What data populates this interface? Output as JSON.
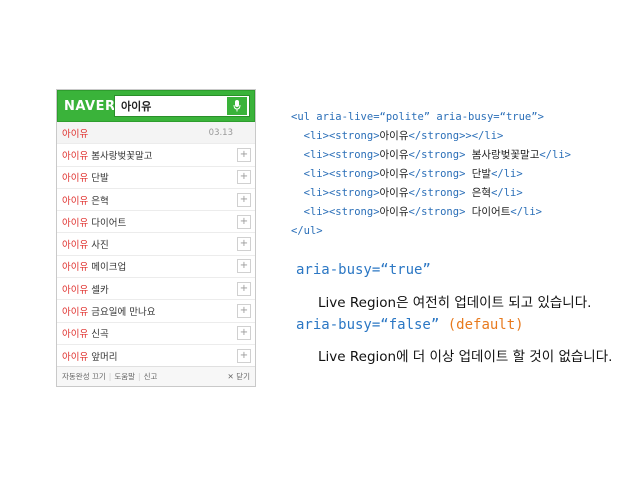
{
  "widget": {
    "logo": "NAVER",
    "query": "아이유",
    "suggestions": [
      {
        "hl": "아이유",
        "rest": "",
        "date": "03.13"
      },
      {
        "hl": "아이유",
        "rest": " 봄사랑벚꽃말고"
      },
      {
        "hl": "아이유",
        "rest": " 단발"
      },
      {
        "hl": "아이유",
        "rest": " 은혁"
      },
      {
        "hl": "아이유",
        "rest": " 다이어트"
      },
      {
        "hl": "아이유",
        "rest": " 사진"
      },
      {
        "hl": "아이유",
        "rest": " 메이크업"
      },
      {
        "hl": "아이유",
        "rest": " 셀카"
      },
      {
        "hl": "아이유",
        "rest": " 금요일에 만나요"
      },
      {
        "hl": "아이유",
        "rest": " 신곡"
      },
      {
        "hl": "아이유",
        "rest": " 앞머리"
      }
    ],
    "plus_label": "+",
    "footer": {
      "autocomplete": "자동완성 끄기",
      "help": "도움말",
      "report": "신고",
      "close": "✕ 닫기",
      "sep": "|"
    }
  },
  "code": {
    "line1_open": "<ul ",
    "line1_attr1": "aria-live=",
    "line1_val1": "“polite”",
    "line1_attr2": " aria-busy=",
    "line1_val2": "“true”",
    "line1_close": ">",
    "li_open": "<li><strong>",
    "strong_close": "</strong>",
    "li_close": "</li>",
    "ul_close": "</ul>",
    "items": [
      {
        "name": "아이유",
        "after": "",
        "suffix": "></li>"
      },
      {
        "name": "아이유",
        "after": "봄사랑벚꽃말고"
      },
      {
        "name": "아이유",
        "after": "단발"
      },
      {
        "name": "아이유",
        "after": "은혁"
      },
      {
        "name": "아이유",
        "after": "다이어트"
      }
    ]
  },
  "explanation": {
    "busy_true": "aria-busy=“true”",
    "busy_true_desc": "Live Region은 여전히 업데이트 되고 있습니다.",
    "busy_false": "aria-busy=“false”",
    "busy_false_default": " (default)",
    "busy_false_desc": "Live Region에 더 이상 업데이트 할 것이 없습니다."
  }
}
